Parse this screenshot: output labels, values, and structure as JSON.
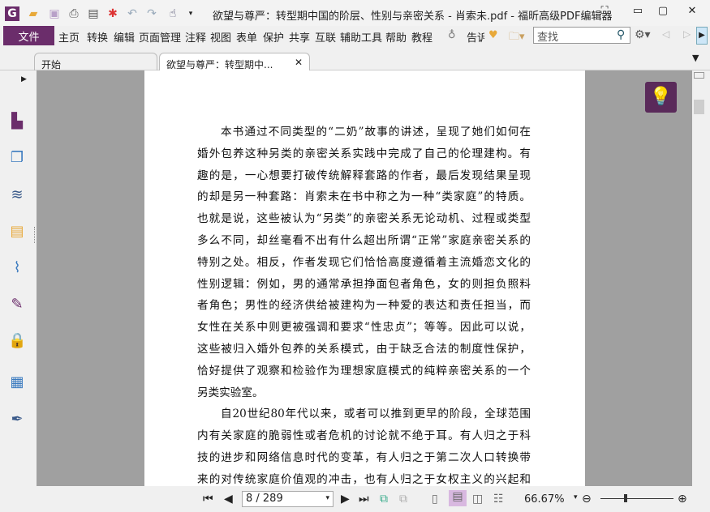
{
  "window": {
    "title": "欲望与尊严：转型期中国的阶层、性别与亲密关系 - 肖索未.pdf - 福昕高级PDF编辑器"
  },
  "menu": {
    "file": "文件",
    "items": [
      "主页",
      "转换",
      "编辑",
      "页面管理",
      "注释",
      "视图",
      "表单",
      "保护",
      "共享",
      "互联",
      "辅助工具",
      "帮助",
      "教程"
    ],
    "tell": "告诉"
  },
  "search": {
    "placeholder": "查找"
  },
  "tabs": [
    {
      "label": "开始"
    },
    {
      "label": "欲望与尊严：转型期中..."
    }
  ],
  "document": {
    "lines": [
      "本书通过不同类型的“二奶”故事的讲述，呈现了她们如何在",
      "婚外包养这种另类的亲密关系实践中完成了自己的伦理建构。有",
      "趣的是，一心想要打破传统解释套路的作者，最后发现结果呈现",
      "的却是另一种套路：肖索未在书中称之为一种“类家庭”的特质。",
      "也就是说，这些被认为“另类”的亲密关系无论动机、过程或类型",
      "多么不同，却丝毫看不出有什么超出所谓“正常”家庭亲密关系的",
      "特别之处。相反，作者发现它们恰恰高度遵循着主流婚恋文化的",
      "性别逻辑：例如，男的通常承担挣面包者角色，女的则担负照料",
      "者角色；男性的经济供给被建构为一种爱的表达和责任担当，而",
      "女性在关系中则更被强调和要求“性忠贞”；等等。因此可以说，",
      "这些被归入婚外包养的关系模式，由于缺乏合法的制度性保护，",
      "恰好提供了观察和检验作为理想家庭模式的纯粹亲密关系的一个",
      "另类实验室。",
      "自20世纪80年代以来，或者可以推到更早的阶段，全球范围",
      "内有关家庭的脆弱性或者危机的讨论就不绝于耳。有人归之于科",
      "技的进步和网络信息时代的变革，有人归之于第二次人口转换带",
      "来的对传统家庭价值观的冲击，也有人归之于女权主义的兴起和"
    ]
  },
  "status": {
    "page": "8 / 289",
    "zoom": "66.67%"
  },
  "colors": {
    "accent": "#6b2d6b",
    "doc_bg": "#a0a0a0"
  }
}
